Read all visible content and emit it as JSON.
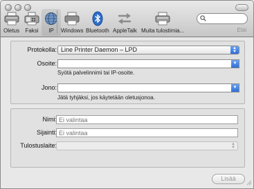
{
  "toolbar": {
    "items": [
      {
        "label": "Oletus",
        "icon": "default-printer-icon"
      },
      {
        "label": "Faksi",
        "icon": "fax-icon"
      },
      {
        "label": "IP",
        "icon": "globe-icon"
      },
      {
        "label": "Windows",
        "icon": "windows-printer-icon"
      },
      {
        "label": "Bluetooth",
        "icon": "bluetooth-icon"
      },
      {
        "label": "AppleTalk",
        "icon": "appletalk-icon"
      },
      {
        "label": "Muita tulostimia...",
        "icon": "more-printers-icon"
      }
    ],
    "search_label": "Etsi",
    "search_value": ""
  },
  "form": {
    "protocol_label": "Protokolla:",
    "protocol_value": "Line Printer Daemon – LPD",
    "address_label": "Osoite:",
    "address_value": "",
    "address_hint": "Syötä palvelinnimi tai IP-osoite.",
    "queue_label": "Jono:",
    "queue_value": "",
    "queue_hint": "Jätä tyhjäksi, jos käytetään oletusjonoa."
  },
  "details": {
    "name_label": "Nimi:",
    "name_placeholder": "Ei valintaa",
    "location_label": "Sijainti:",
    "location_placeholder": "Ei valintaa",
    "device_label": "Tulostuslaite:",
    "device_value": ""
  },
  "footer": {
    "add_label": "Lisää"
  },
  "colors": {
    "accent": "#3a7be0",
    "toolbar_top": "#e9e9e9",
    "toolbar_bottom": "#c6c6c6"
  }
}
